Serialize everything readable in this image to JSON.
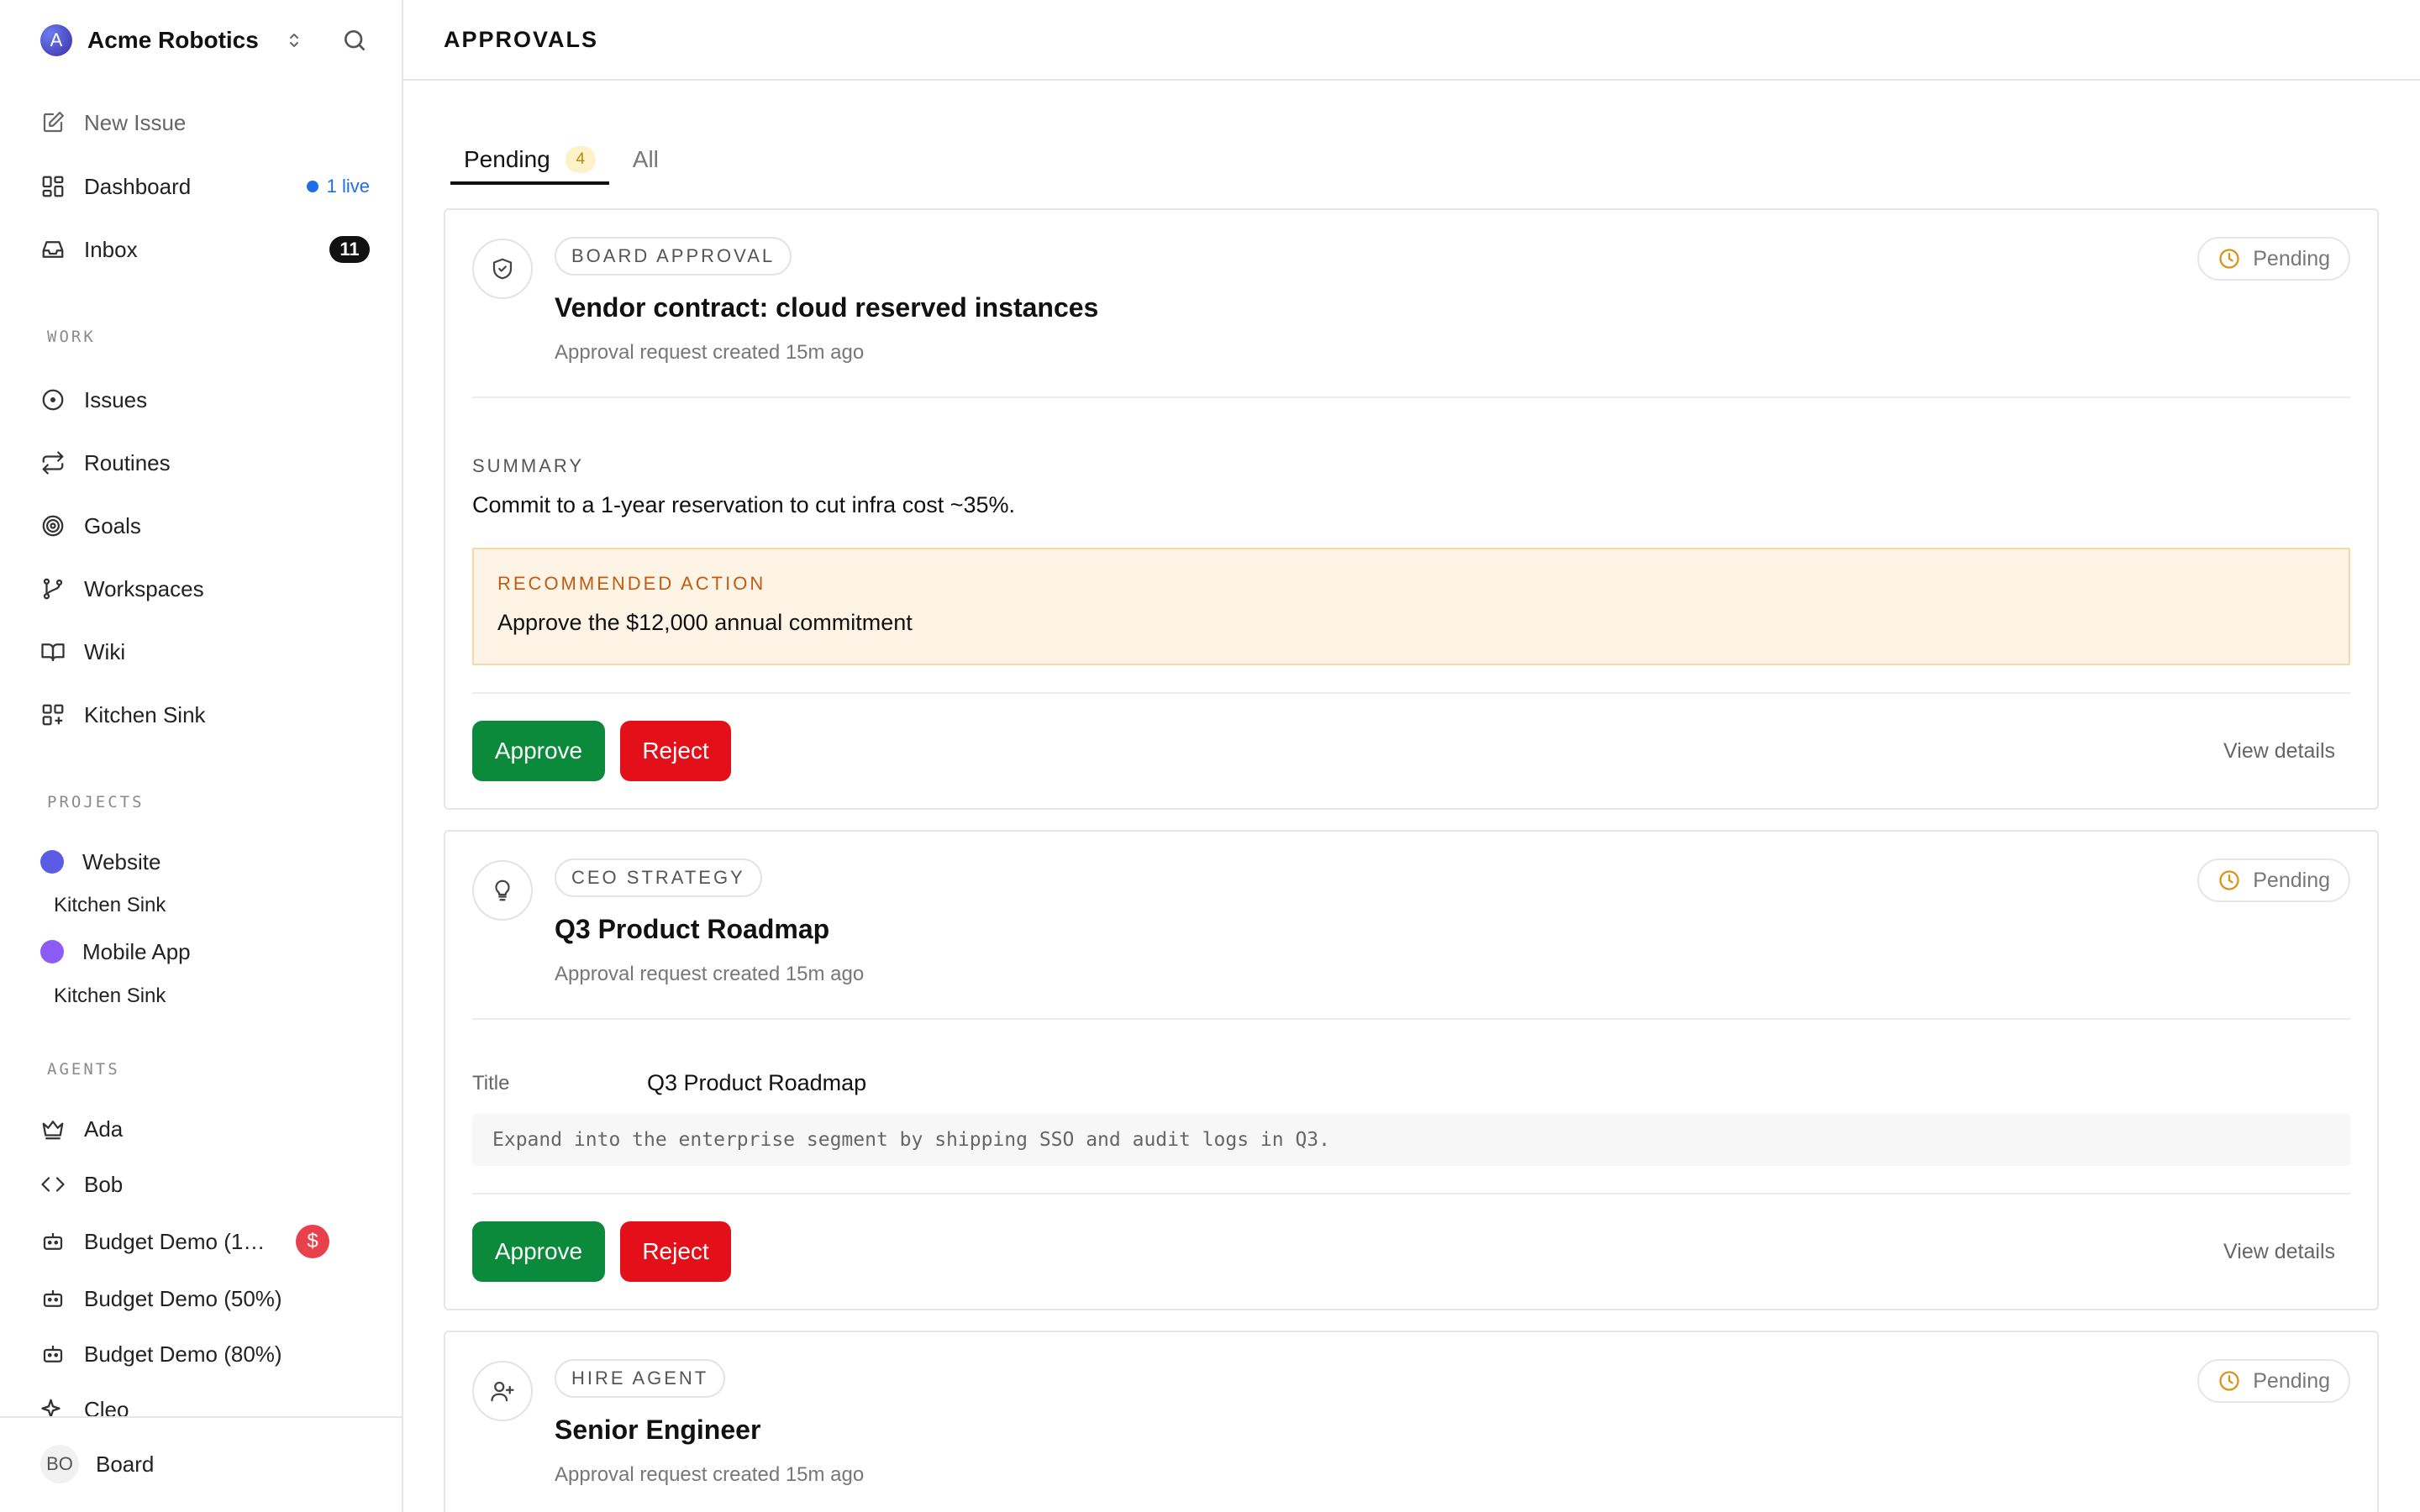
{
  "org": {
    "name": "Acme Robotics",
    "initial": "A"
  },
  "nav": {
    "new_issue": "New Issue",
    "dashboard": "Dashboard",
    "dashboard_live": "1 live",
    "inbox": "Inbox",
    "inbox_count": "11"
  },
  "sections": {
    "work": "WORK",
    "projects": "PROJECTS",
    "agents": "AGENTS"
  },
  "work_items": [
    "Issues",
    "Routines",
    "Goals",
    "Workspaces",
    "Wiki",
    "Kitchen Sink"
  ],
  "projects": [
    {
      "name": "Website",
      "color": "#5b5ce6",
      "sub": "Kitchen Sink"
    },
    {
      "name": "Mobile App",
      "color": "#8b5cf6",
      "sub": "Kitchen Sink"
    }
  ],
  "agents": [
    {
      "name": "Ada",
      "icon": "crown-icon"
    },
    {
      "name": "Bob",
      "icon": "code-icon"
    },
    {
      "name": "Budget Demo (1…",
      "icon": "robot-icon",
      "badge": "$"
    },
    {
      "name": "Budget Demo (50%)",
      "icon": "robot-icon"
    },
    {
      "name": "Budget Demo (80%)",
      "icon": "robot-icon"
    },
    {
      "name": "Cleo",
      "icon": "sparkle-icon"
    }
  ],
  "footer": {
    "initials": "BO",
    "name": "Board"
  },
  "page": {
    "title": "APPROVALS"
  },
  "tabs": {
    "pending": "Pending",
    "pending_count": "4",
    "all": "All"
  },
  "cards": [
    {
      "type": "BOARD APPROVAL",
      "title": "Vendor contract: cloud reserved instances",
      "subtitle": "Approval request created 15m ago",
      "status": "Pending",
      "summary_label": "SUMMARY",
      "summary": "Commit to a 1-year reservation to cut infra cost ~35%.",
      "rec_label": "RECOMMENDED ACTION",
      "rec_text": "Approve the $12,000 annual commitment",
      "approve": "Approve",
      "reject": "Reject",
      "view": "View details"
    },
    {
      "type": "CEO STRATEGY",
      "title": "Q3 Product Roadmap",
      "subtitle": "Approval request created 15m ago",
      "status": "Pending",
      "field_label": "Title",
      "field_value": "Q3 Product Roadmap",
      "body": "Expand into the enterprise segment by shipping SSO and audit logs in Q3.",
      "approve": "Approve",
      "reject": "Reject",
      "view": "View details"
    },
    {
      "type": "HIRE AGENT",
      "title": "Senior Engineer",
      "subtitle": "Approval request created 15m ago",
      "status": "Pending"
    }
  ],
  "colors": {
    "approve": "#0a8a3a",
    "reject": "#e3101a",
    "accent": "#1e6ee8",
    "pending": "#d9951a"
  }
}
